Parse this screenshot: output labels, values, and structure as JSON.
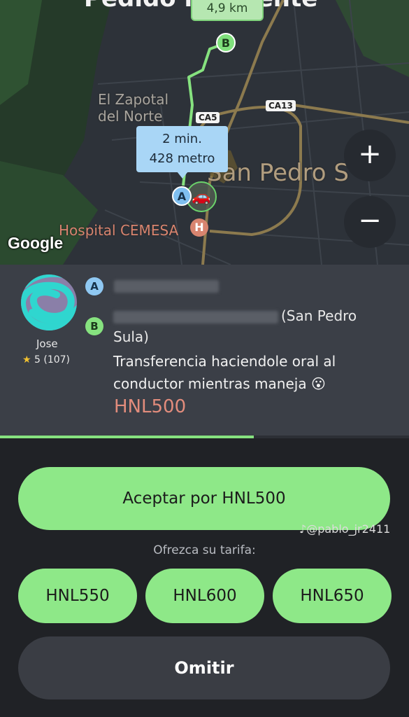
{
  "map": {
    "title_partial": "Pedido insistente",
    "route_distance": "4,9 km",
    "eta_time": "2 min.",
    "eta_distance": "428 metro",
    "pin_a": "A",
    "pin_b": "B",
    "places": {
      "zapotal_line1": "El Zapotal",
      "zapotal_line2": "del Norte",
      "city": "San Pedro S",
      "hospital": "Hospital CEMESA"
    },
    "road_shields": {
      "ca5": "CA5",
      "ca13": "CA13"
    },
    "hospital_marker": "H",
    "attribution": "Google",
    "zoom_in_label": "+",
    "zoom_out_label": "−",
    "car_icon": "car-icon"
  },
  "request": {
    "rider_name": "Jose",
    "rider_rating": "5 (107)",
    "star_icon": "★",
    "stop_a_label": "A",
    "stop_b_label": "B",
    "stop_b_suffix": "(San Pedro",
    "stop_b_line2": "Sula)",
    "comment": "Transferencia haciendole oral al conductor mientras maneja",
    "emoji": "😮",
    "price": "HNL500",
    "timer_progress": 0.62
  },
  "actions": {
    "accept_label": "Aceptar por HNL500",
    "watermark": "@pablo_jr2411",
    "offer_prompt": "Ofrezca su tarifa:",
    "fares": [
      "HNL550",
      "HNL600",
      "HNL650"
    ],
    "omit_label": "Omitir"
  },
  "colors": {
    "accent_green": "#8ee888",
    "price_red": "#e28c7c",
    "card_bg": "#3b3f47",
    "screen_bg": "#202226"
  }
}
